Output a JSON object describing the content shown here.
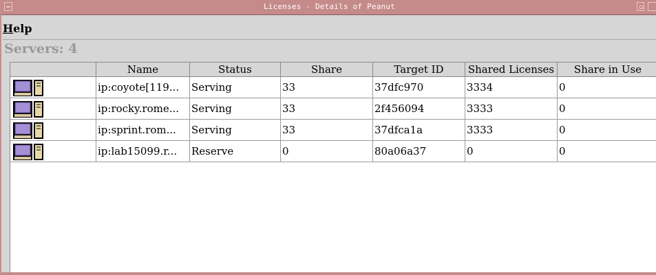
{
  "window": {
    "title": "Licenses - Details of Peanut"
  },
  "menu": {
    "help_first": "H",
    "help_rest": "elp"
  },
  "servers_label": "Servers: 4",
  "table": {
    "columns": [
      "",
      "Name",
      "Status",
      "Share",
      "Target ID",
      "Shared Licenses",
      "Share in Use"
    ],
    "rows": [
      {
        "icon": "server-icon",
        "name": "ip:coyote[119...",
        "status": "Serving",
        "share": "33",
        "target_id": "37dfc970",
        "shared_licenses": "3334",
        "share_in_use": "0"
      },
      {
        "icon": "server-icon",
        "name": "ip:rocky.rome...",
        "status": "Serving",
        "share": "33",
        "target_id": "2f456094",
        "shared_licenses": "3333",
        "share_in_use": "0"
      },
      {
        "icon": "server-icon",
        "name": "ip:sprint.rom...",
        "status": "Serving",
        "share": "33",
        "target_id": "37dfca1a",
        "shared_licenses": "3333",
        "share_in_use": "0"
      },
      {
        "icon": "server-icon",
        "name": "ip:lab15099.r...",
        "status": "Reserve",
        "share": "0",
        "target_id": "80a06a37",
        "shared_licenses": "0",
        "share_in_use": "0"
      }
    ]
  },
  "colors": {
    "titlebar": "#c58a8a",
    "window_bg": "#d6d6d6",
    "servers_label": "#9a9a9a"
  }
}
